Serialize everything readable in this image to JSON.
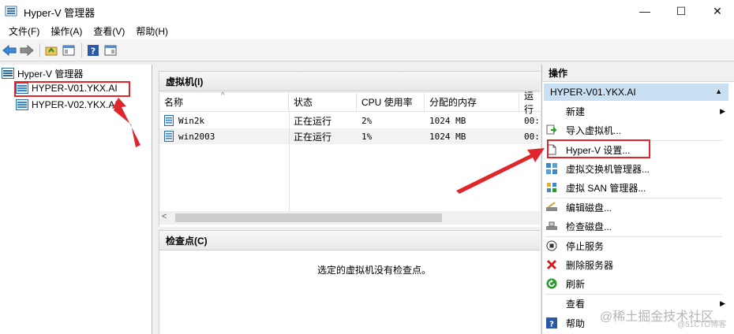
{
  "window": {
    "title": "Hyper-V 管理器",
    "minimize": "—",
    "maximize": "☐",
    "close": "✕"
  },
  "menu": [
    "文件(F)",
    "操作(A)",
    "查看(V)",
    "帮助(H)"
  ],
  "tree": {
    "root": "Hyper-V 管理器",
    "servers": [
      "HYPER-V01.YKX.AI",
      "HYPER-V02.YKX.AI"
    ]
  },
  "vm_panel": {
    "title": "虚拟机(I)",
    "columns": [
      "名称",
      "状态",
      "CPU 使用率",
      "分配的内存",
      "运行"
    ],
    "rows": [
      {
        "name": "Win2k",
        "status": "正在运行",
        "cpu": "2%",
        "memory": "1024 MB",
        "uptime": "00:"
      },
      {
        "name": "win2003",
        "status": "正在运行",
        "cpu": "1%",
        "memory": "1024 MB",
        "uptime": "00:"
      }
    ]
  },
  "checkpoint_panel": {
    "title": "检查点(C)",
    "empty_message": "选定的虚拟机没有检查点。"
  },
  "actions": {
    "title": "操作",
    "server": "HYPER-V01.YKX.AI",
    "items": [
      {
        "label": "新建",
        "icon": "blank-icon"
      },
      {
        "label": "导入虚拟机...",
        "icon": "import-vm-icon"
      },
      {
        "label": "Hyper-V 设置...",
        "icon": "settings-document-icon"
      },
      {
        "label": "虚拟交换机管理器...",
        "icon": "virtual-switch-icon"
      },
      {
        "label": "虚拟 SAN 管理器...",
        "icon": "virtual-san-icon"
      },
      {
        "label": "编辑磁盘...",
        "icon": "edit-disk-icon"
      },
      {
        "label": "检查磁盘...",
        "icon": "inspect-disk-icon"
      },
      {
        "label": "停止服务",
        "icon": "stop-service-icon"
      },
      {
        "label": "删除服务器",
        "icon": "delete-server-icon"
      },
      {
        "label": "刷新",
        "icon": "refresh-icon"
      },
      {
        "label": "查看",
        "icon": "blank-icon"
      },
      {
        "label": "帮助",
        "icon": "help-icon"
      }
    ]
  },
  "watermark": "@稀土掘金技术社区",
  "watermark_small": "@51CTO博客",
  "colors": {
    "highlight": "#e0262a",
    "selected_server": "#c9dff2"
  }
}
